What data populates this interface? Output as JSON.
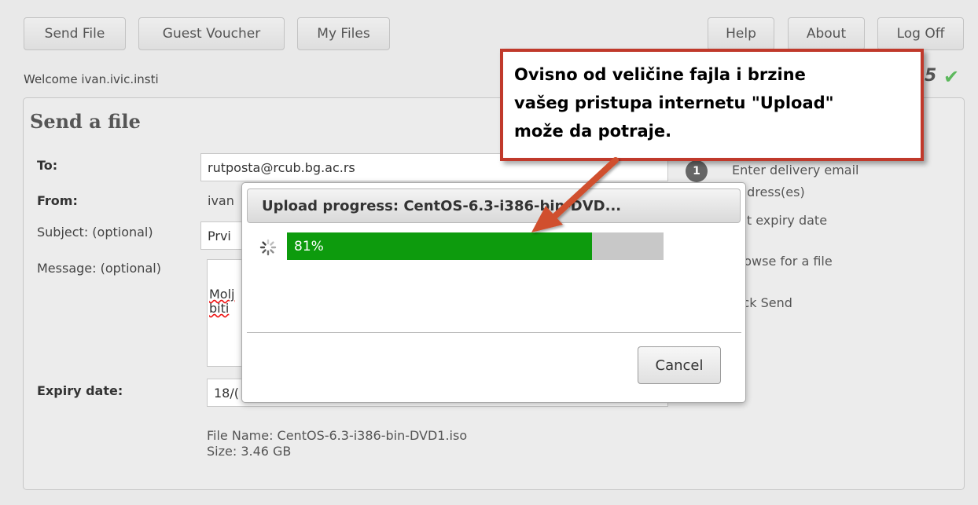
{
  "nav": {
    "send_file": "Send File",
    "guest_voucher": "Guest Voucher",
    "my_files": "My Files",
    "help": "Help",
    "about": "About",
    "log_off": "Log Off"
  },
  "welcome": "Welcome ivan.ivic.insti",
  "version_mark": "5",
  "form": {
    "title": "Send a file",
    "to_label": "To:",
    "to_value": "rutposta@rcub.bg.ac.rs",
    "from_label": "From:",
    "from_value": "ivan",
    "subject_label": "Subject: (optional)",
    "subject_value": "Prvi",
    "message_label": "Message: (optional)",
    "message_line1": "Molj",
    "message_line2": "biti",
    "expiry_label": "Expiry date:",
    "expiry_value": "18/("
  },
  "steps": {
    "step1_number": "1",
    "step1_line1": "Enter delivery email",
    "step1_line2": "ddress(es)",
    "step2": "et expiry date",
    "step3": "rowse for a file",
    "step4": "ick Send"
  },
  "file_info": {
    "name": "File Name: CentOS-6.3-i386-bin-DVD1.iso",
    "size": "Size: 3.46 GB"
  },
  "upload_dialog": {
    "title": "Upload progress: CentOS-6.3-i386-bin-DVD...",
    "progress_percent": 81,
    "progress_text": "81%",
    "cancel": "Cancel"
  },
  "callout": {
    "line1": "Ovisno od veličine fajla i brzine",
    "line2": "vašeg pristupa internetu \"Upload\"",
    "line3": "može da potraje."
  },
  "colors": {
    "progress_fill": "#0d9b0d",
    "callout_border": "#c0392b",
    "arrow": "#d0502e",
    "check": "#5cb85c"
  }
}
